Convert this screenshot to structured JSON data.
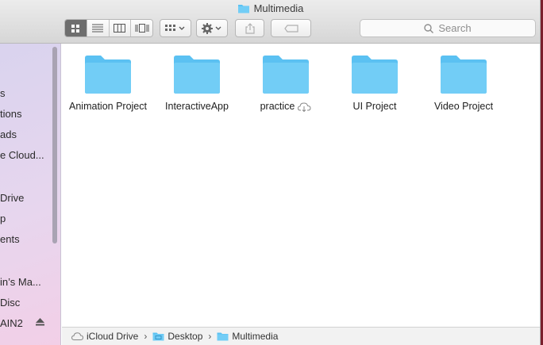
{
  "window": {
    "title": "Multimedia"
  },
  "toolbar": {
    "view_modes": [
      "icon-view-icon",
      "list-view-icon",
      "column-view-icon",
      "cover-flow-icon"
    ],
    "active_view": 0,
    "search_placeholder": "Search"
  },
  "sidebar": {
    "items": [
      {
        "label": "s"
      },
      {
        "label": "tions"
      },
      {
        "label": "ads"
      },
      {
        "label": "e Cloud..."
      },
      {
        "label": "Drive"
      },
      {
        "label": "p"
      },
      {
        "label": "ents"
      },
      {
        "label": "in’s Ma..."
      },
      {
        "label": " Disc"
      },
      {
        "label": "AIN2"
      }
    ]
  },
  "files": [
    {
      "name": "Animation Project",
      "cloud": false
    },
    {
      "name": "InteractiveApp",
      "cloud": false
    },
    {
      "name": "practice",
      "cloud": true
    },
    {
      "name": "UI Project",
      "cloud": false
    },
    {
      "name": "Video Project",
      "cloud": false
    }
  ],
  "pathbar": [
    "iCloud Drive",
    "Desktop",
    "Multimedia"
  ],
  "colors": {
    "folder": "#5bc1f2",
    "folder_tab": "#72cdf6",
    "active_segment": "#6e6e6e"
  }
}
